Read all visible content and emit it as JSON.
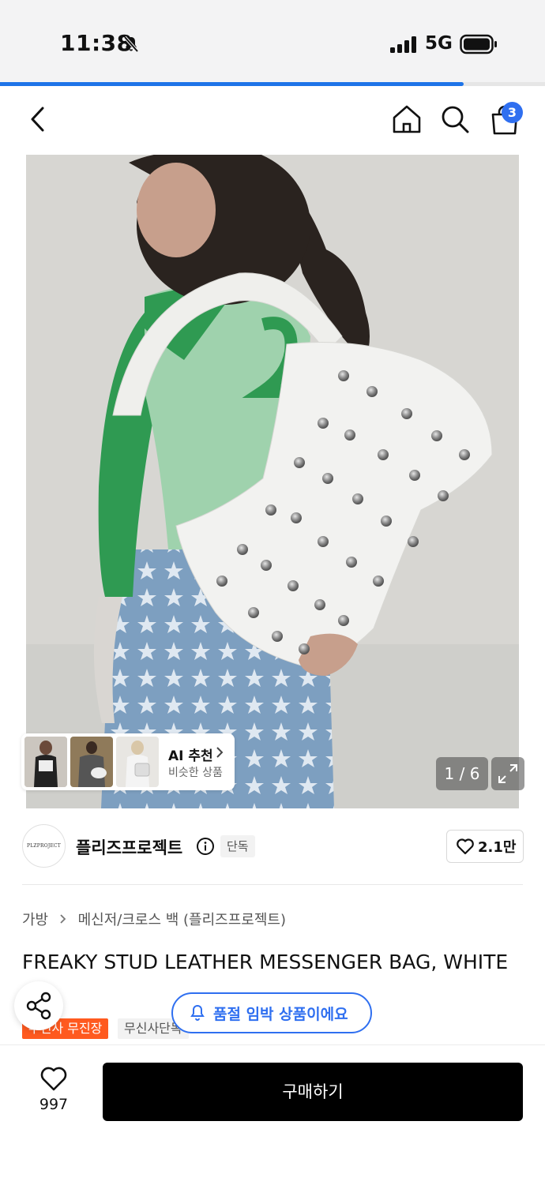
{
  "status_bar": {
    "time": "11:38",
    "network": "5G"
  },
  "page_load_progress": 0.85,
  "nav": {
    "cart_count": "3"
  },
  "gallery": {
    "counter": "1 / 6"
  },
  "ai_recommend": {
    "title": "AI 추천",
    "subtitle": "비슷한 상품"
  },
  "brand": {
    "logo_text": "PLZPROJECT",
    "name": "플리즈프로젝트",
    "exclusive_badge": "단독",
    "likes": "2.1만"
  },
  "product": {
    "category": "가방",
    "subcategory": "메신저/크로스 백 (플리즈프로젝트)",
    "title": "FREAKY STUD LEATHER MESSENGER BAG, WHITE",
    "tags": [
      "무신사 무진장",
      "무신사단독"
    ]
  },
  "alert": {
    "soldout_soon": "품절 임박 상품이에요"
  },
  "bottom": {
    "wish_count": "997",
    "buy_label": "구매하기"
  },
  "colors": {
    "accent": "#2f6ff0",
    "promo": "#ff5a1f",
    "buy_button": "#000000"
  }
}
